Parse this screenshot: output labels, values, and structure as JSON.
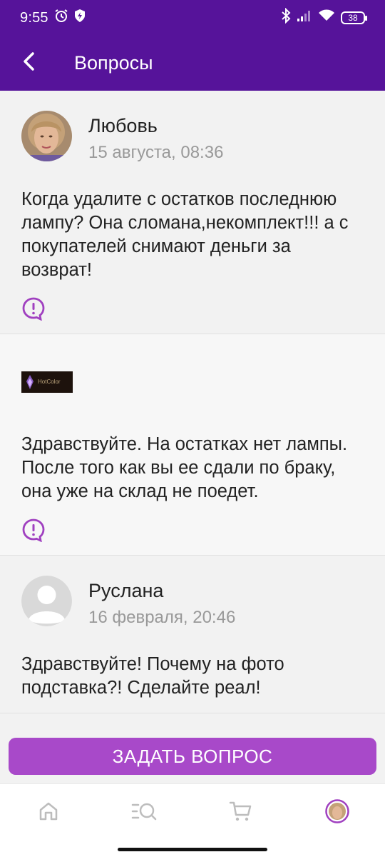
{
  "status_bar": {
    "time": "9:55",
    "battery": "38",
    "icons": [
      "alarm-icon",
      "shield-bolt-icon",
      "bluetooth-icon",
      "signal-icon",
      "wifi-icon",
      "battery-icon"
    ]
  },
  "app_bar": {
    "title": "Вопросы",
    "back_icon": "back-arrow-icon"
  },
  "questions": [
    {
      "type": "question",
      "author": "Любовь",
      "date": "15 августа, 08:36",
      "text": "Когда удалите с остатков последнюю лампу? Она сломана,некомплект!!! а с покупателей снимают деньги за возврат!",
      "avatar": "user-photo-female"
    },
    {
      "type": "answer",
      "brand_logo_text": "HotColor",
      "text": "Здравствуйте. На остатках нет лампы. После того как вы ее сдали по браку, она уже на склад не поедет."
    },
    {
      "type": "question",
      "author": "Руслана",
      "date": "16 февраля, 20:46",
      "text": "Здравствуйте! Почему на фото подставка?! Сделайте реал!",
      "avatar": "user-placeholder"
    }
  ],
  "cta": {
    "label": "ЗАДАТЬ ВОПРОС"
  },
  "bottom_nav": [
    {
      "icon": "home-icon"
    },
    {
      "icon": "catalog-search-icon"
    },
    {
      "icon": "cart-icon"
    },
    {
      "icon": "profile-avatar-icon"
    }
  ],
  "colors": {
    "primary": "#56139a",
    "accent": "#a849c9",
    "report_icon": "#a040c0"
  }
}
